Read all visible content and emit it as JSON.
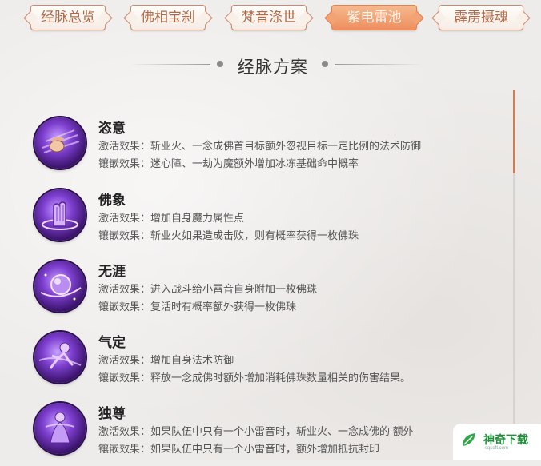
{
  "tabs": [
    {
      "label": "经脉总览",
      "active": false
    },
    {
      "label": "佛相宝刹",
      "active": false
    },
    {
      "label": "梵音涤世",
      "active": false
    },
    {
      "label": "紫电雷池",
      "active": true
    },
    {
      "label": "霹雳摄魂",
      "active": false
    }
  ],
  "section_title": "经脉方案",
  "entries": [
    {
      "name": "恣意",
      "icon": "palm-strike-icon",
      "activate": "激活效果：斩业火、一念成佛首目标额外忽视目标一定比例的法术防御",
      "inlay": "镶嵌效果：迷心障、一劫为魔额外增加冰冻基础命中概率"
    },
    {
      "name": "佛象",
      "icon": "praying-hand-icon",
      "activate": "激活效果：增加自身魔力属性点",
      "inlay": "镶嵌效果：斩业火如果造成击败，则有概率获得一枚佛珠"
    },
    {
      "name": "无涯",
      "icon": "orb-icon",
      "activate": "激活效果：进入战斗给小雷音自身附加一枚佛珠",
      "inlay": "镶嵌效果：复活时有概率额外获得一枚佛珠"
    },
    {
      "name": "气定",
      "icon": "spirit-figure-icon",
      "activate": "激活效果：增加自身法术防御",
      "inlay": "镶嵌效果：释放一念成佛时额外增加消耗佛珠数量相关的伤害结果。"
    },
    {
      "name": "独尊",
      "icon": "monk-figure-icon",
      "activate": "激活效果：如果队伍中只有一个小雷音时，斩业火、一念成佛的 额外",
      "inlay": "镶嵌效果：如果队伍中只有一个小雷音时，额外增加抵抗封印"
    }
  ],
  "watermark": {
    "name": "神奇下载",
    "sub": "sqsoft.com",
    "icon": "leaf-logo-icon"
  },
  "colors": {
    "accent": "#ee8f5d",
    "tab_border": "#c98b6c",
    "tab_text": "#b06a4a",
    "icon_purple": "#7e3fd0",
    "scroll_thumb": "#c97f57"
  }
}
